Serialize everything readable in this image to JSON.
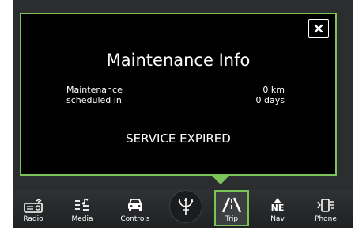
{
  "popup": {
    "title": "Maintenance Info",
    "close_label": "×",
    "label_line1": "Maintenance",
    "label_line2": "scheduled in",
    "distance": "0 km",
    "time": "0 days",
    "status": "SERVICE EXPIRED"
  },
  "navbar": {
    "items": [
      {
        "label": "Radio",
        "icon": "radio-icon"
      },
      {
        "label": "Media",
        "icon": "media-icon"
      },
      {
        "label": "Controls",
        "icon": "car-icon"
      },
      {
        "label": "",
        "icon": "trident-logo-icon"
      },
      {
        "label": "Trip",
        "icon": "road-icon"
      },
      {
        "label": "Nav",
        "icon": "compass-icon",
        "compass_text": "NE"
      },
      {
        "label": "Phone",
        "icon": "phone-icon"
      }
    ],
    "active": "Trip"
  },
  "colors": {
    "accent": "#7cc35a",
    "background": "#000000",
    "bar": "#2b2d2f"
  }
}
